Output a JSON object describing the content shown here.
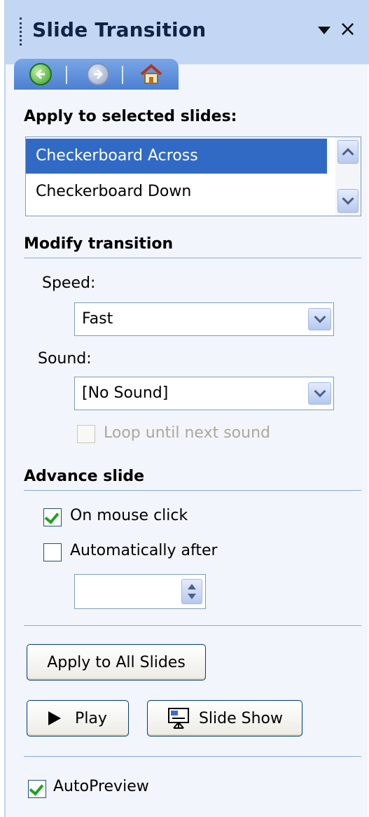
{
  "panel": {
    "title": "Slide Transition",
    "close_glyph": "×",
    "menu_icon": "dropdown-arrow-icon"
  },
  "nav": {
    "back_icon": "back-arrow-icon",
    "forward_icon": "forward-arrow-icon",
    "home_icon": "home-icon"
  },
  "apply_section": {
    "heading": "Apply to selected slides:",
    "items": [
      "Checkerboard Across",
      "Checkerboard Down"
    ],
    "selected_index": 0
  },
  "modify_section": {
    "heading": "Modify transition",
    "speed_label": "Speed:",
    "speed_value": "Fast",
    "sound_label": "Sound:",
    "sound_value": "[No Sound]",
    "loop_label": "Loop until next sound",
    "loop_checked": false,
    "loop_disabled": true
  },
  "advance_section": {
    "heading": "Advance slide",
    "on_click_label": "On mouse click",
    "on_click_checked": true,
    "auto_label": "Automatically after",
    "auto_checked": false,
    "auto_value": ""
  },
  "buttons": {
    "apply_all": "Apply to All Slides",
    "play": "Play",
    "slide_show": "Slide Show"
  },
  "autopreview": {
    "label": "AutoPreview",
    "checked": true
  },
  "colors": {
    "title_bg": "#c3d7f4",
    "nav_bg": "#4b7fd0",
    "selection": "#316ac5",
    "check": "#21a121"
  }
}
